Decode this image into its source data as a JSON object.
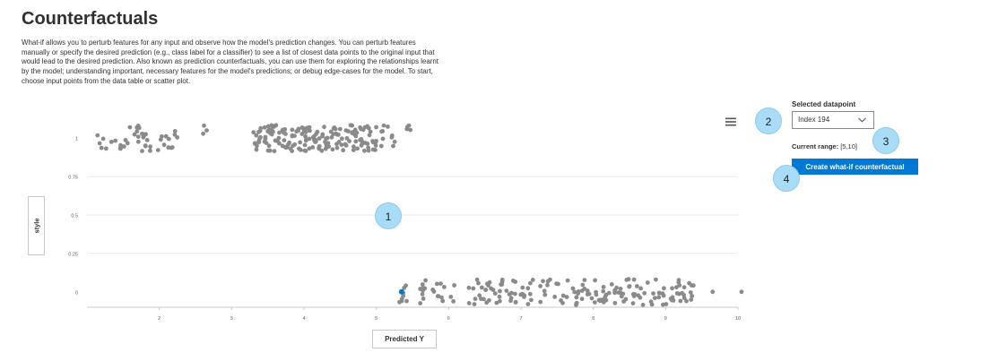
{
  "page": {
    "title": "Counterfactuals",
    "description": "What-if allows you to perturb features for any input and observe how the model's prediction changes. You can perturb features manually or specify the desired prediction (e.g., class label for a classifier) to see a list of closest data points to the original input that would lead to the desired prediction. Also known as prediction counterfactuals, you can use them for exploring the relationships learnt by the model; understanding important, necessary features for the model's predictions; or debug edge-cases for the model. To start, choose input points from the data table or scatter plot."
  },
  "panel": {
    "selected_label": "Selected datapoint",
    "selected_value": "Index 194",
    "range_label": "Current range:",
    "range_value": "[5,10]",
    "create_button": "Create what-if counterfactual"
  },
  "chart": {
    "x_axis_button": "Predicted Y",
    "y_axis_button": "style",
    "menu_icon": "hamburger-menu-icon"
  },
  "chart_data": {
    "type": "scatter",
    "xlabel": "Predicted Y",
    "ylabel": "style",
    "xlim": [
      1,
      10
    ],
    "ylim": [
      -0.1,
      1.1
    ],
    "x_ticks": [
      "2",
      "3",
      "4",
      "5",
      "6",
      "7",
      "8",
      "9",
      "10"
    ],
    "y_ticks": [
      "0",
      "0.25",
      "0.5",
      "0.75",
      "1"
    ],
    "grid": "horizontal",
    "point_color": "#8a8a8a",
    "selected_color": "#0078d4",
    "selected_point": {
      "x": 5.35,
      "y": 0
    },
    "series": [
      {
        "clusters": [
          {
            "y": 1,
            "x_min": 1.05,
            "x_max": 2.25,
            "count": 45
          },
          {
            "y": 1,
            "x_min": 2.5,
            "x_max": 2.85,
            "count": 3
          },
          {
            "y": 1,
            "x_min": 3.3,
            "x_max": 5.0,
            "count": 170
          },
          {
            "y": 1,
            "x_min": 5.05,
            "x_max": 5.5,
            "count": 14
          },
          {
            "y": 0,
            "x_min": 5.3,
            "x_max": 5.45,
            "count": 8
          },
          {
            "y": 0,
            "x_min": 5.6,
            "x_max": 9.4,
            "count": 185
          }
        ],
        "outliers": [
          {
            "x": 9.65,
            "y": 0
          },
          {
            "x": 10.05,
            "y": 0
          }
        ]
      }
    ]
  },
  "badges": [
    "1",
    "2",
    "3",
    "4"
  ]
}
